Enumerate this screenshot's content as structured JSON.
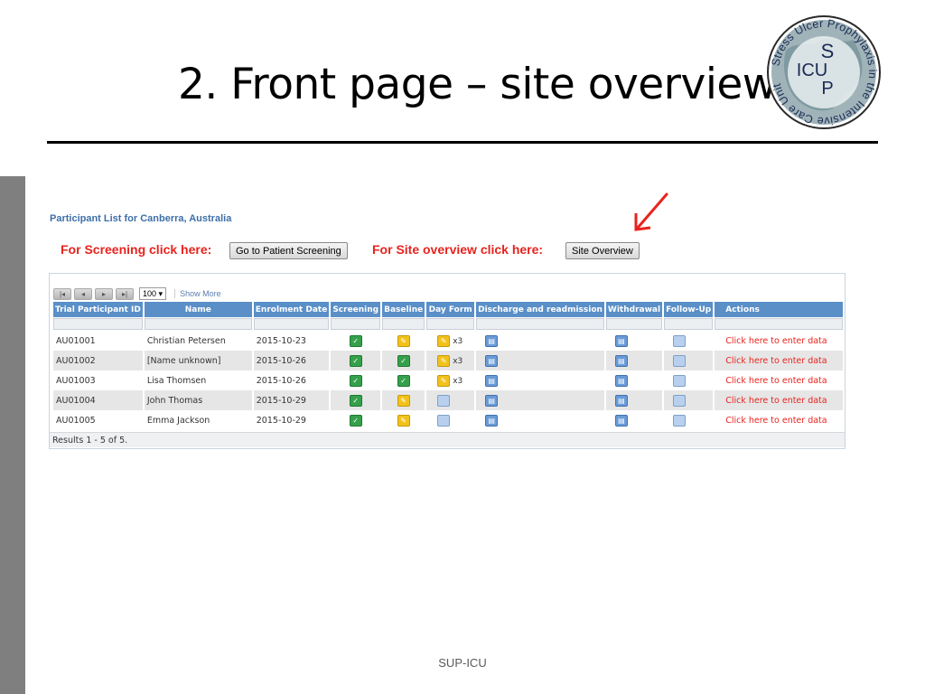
{
  "slide": {
    "title": "2. Front page – site overview",
    "footer": "SUP-ICU",
    "logo": {
      "center_text": [
        "S",
        "ICU",
        "U",
        "P"
      ],
      "ring_text": "Stress Ulcer Prophylaxis in the Intensive Care Unit"
    }
  },
  "app": {
    "participant_title": "Participant List for Canberra, Australia",
    "screening_cta": "For Screening click here:",
    "screening_button": "Go to Patient Screening",
    "site_cta": "For Site overview click here:",
    "site_button": "Site Overview",
    "pager": {
      "first": "|◂",
      "prev": "◂",
      "next": "▸",
      "last": "▸|",
      "page_size": "100",
      "show_more": "Show More"
    },
    "columns": [
      "Trial Participant ID",
      "Name",
      "Enrolment Date",
      "Screening",
      "Baseline",
      "Day Form",
      "Discharge and readmission",
      "Withdrawal",
      "Follow-Up",
      "Actions"
    ],
    "rows": [
      {
        "id": "AU01001",
        "name": "Christian Petersen",
        "date": "2015-10-23",
        "day_count": "x3",
        "action": "Click here to enter data"
      },
      {
        "id": "AU01002",
        "name": "[Name unknown]",
        "date": "2015-10-26",
        "day_count": "x3",
        "action": "Click here to enter data"
      },
      {
        "id": "AU01003",
        "name": "Lisa Thomsen",
        "date": "2015-10-26",
        "day_count": "x3",
        "action": "Click here to enter data"
      },
      {
        "id": "AU01004",
        "name": "John Thomas",
        "date": "2015-10-29",
        "day_count": "",
        "action": "Click here to enter data"
      },
      {
        "id": "AU01005",
        "name": "Emma Jackson",
        "date": "2015-10-29",
        "day_count": "",
        "action": "Click here to enter data"
      }
    ],
    "results_text": "Results 1 - 5 of 5."
  },
  "colors": {
    "header_blue": "#5a8fc8",
    "cta_red": "#e8231e",
    "title_blue": "#3e6fa8"
  },
  "icons": {
    "screening": "green-check-icon",
    "baseline": [
      "yellow-form-icon",
      "green-check-icon",
      "green-check-icon",
      "yellow-form-icon",
      "yellow-form-icon"
    ],
    "day_form": [
      "yellow-form-icon",
      "yellow-form-icon",
      "yellow-form-icon",
      "blank-form-icon",
      "blank-form-icon"
    ],
    "discharge": "blue-form-icon",
    "withdrawal": "blue-form-icon",
    "follow_up": "blank-form-icon"
  }
}
